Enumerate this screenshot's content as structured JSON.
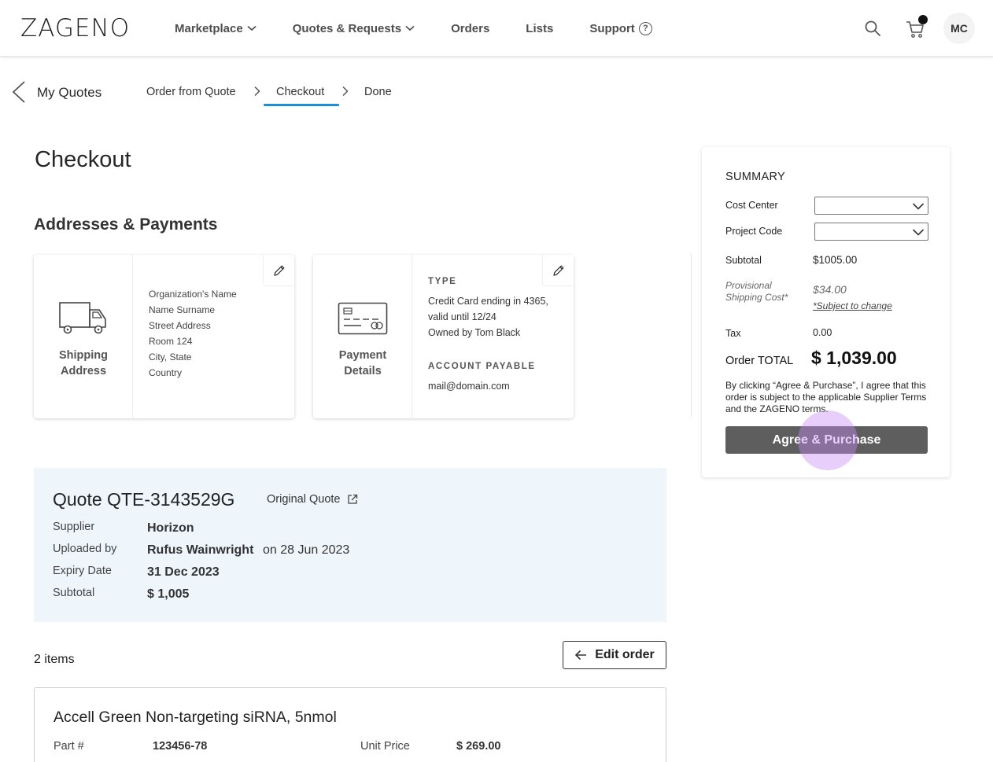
{
  "header": {
    "logo": "ZAGENO",
    "nav": [
      {
        "label": "Marketplace"
      },
      {
        "label": "Quotes & Requests"
      },
      {
        "label": "Orders"
      },
      {
        "label": "Lists"
      },
      {
        "label": "Support"
      }
    ],
    "support_help_glyph": "?",
    "avatar_initials": "MC",
    "icons": [
      "search-icon",
      "cart-icon",
      "help-circle-icon",
      "chevron-down-icon"
    ]
  },
  "breadcrumb": {
    "back_label": "My Quotes",
    "steps": [
      "Order from Quote",
      "Checkout",
      "Done"
    ],
    "active_step": "Checkout",
    "accent": "#1a8fd6"
  },
  "page_title": "Checkout",
  "addresses_section": {
    "title": "Addresses & Payments",
    "shipping": {
      "label_line1": "Shipping",
      "label_line2": "Address",
      "lines": [
        "Organization's Name",
        "Name Surname",
        "Street Address",
        "Room 124",
        "City, State",
        "Country"
      ]
    },
    "payment": {
      "label_line1": "Payment",
      "label_line2": "Details",
      "type_title": "TYPE",
      "type_lines": [
        "Credit Card ending in 4365,",
        "valid until 12/24",
        "Owned by Tom Black"
      ],
      "ap_title": "ACCOUNT PAYABLE",
      "ap_email": "mail@domain.com"
    }
  },
  "summary": {
    "title": "SUMMARY",
    "cost_center_label": "Cost Center",
    "cost_center_value": "",
    "project_code_label": "Project Code",
    "project_code_value": "",
    "subtotal_label": "Subtotal",
    "subtotal_value": "$1005.00",
    "shipping_label_line1": "Provisional",
    "shipping_label_line2": "Shipping Cost*",
    "shipping_value": "$34.00",
    "shipping_note": "*Subject to change",
    "tax_label": "Tax",
    "tax_value": "0.00",
    "total_label": "Order TOTAL",
    "total_value": "$ 1,039.00",
    "terms": "By clicking “Agree & Purchase”, I agree that this order is subject to the applicable Supplier Terms and the ZAGENO terms.",
    "button": "Agree & Purchase",
    "button_color": "#5e5e5e"
  },
  "quote": {
    "title": "Quote QTE-3143529G",
    "original_link": "Original Quote",
    "supplier_label": "Supplier",
    "supplier_value": "Horizon",
    "uploaded_label": "Uploaded by",
    "uploaded_value": "Rufus Wainwright",
    "uploaded_date": "on 28 Jun 2023",
    "expiry_label": "Expiry Date",
    "expiry_value": "31 Dec 2023",
    "subtotal_label": "Subtotal",
    "subtotal_value": "$ 1,005",
    "panel_color": "#eef6fc"
  },
  "items": {
    "count_label": "2 items",
    "edit_button": "Edit order",
    "list": [
      {
        "name": "Accell Green Non-targeting siRNA, 5nmol",
        "part_label": "Part #",
        "part_value": "123456-78",
        "unit_price_label": "Unit Price",
        "unit_price_value": "$ 269.00"
      }
    ]
  }
}
